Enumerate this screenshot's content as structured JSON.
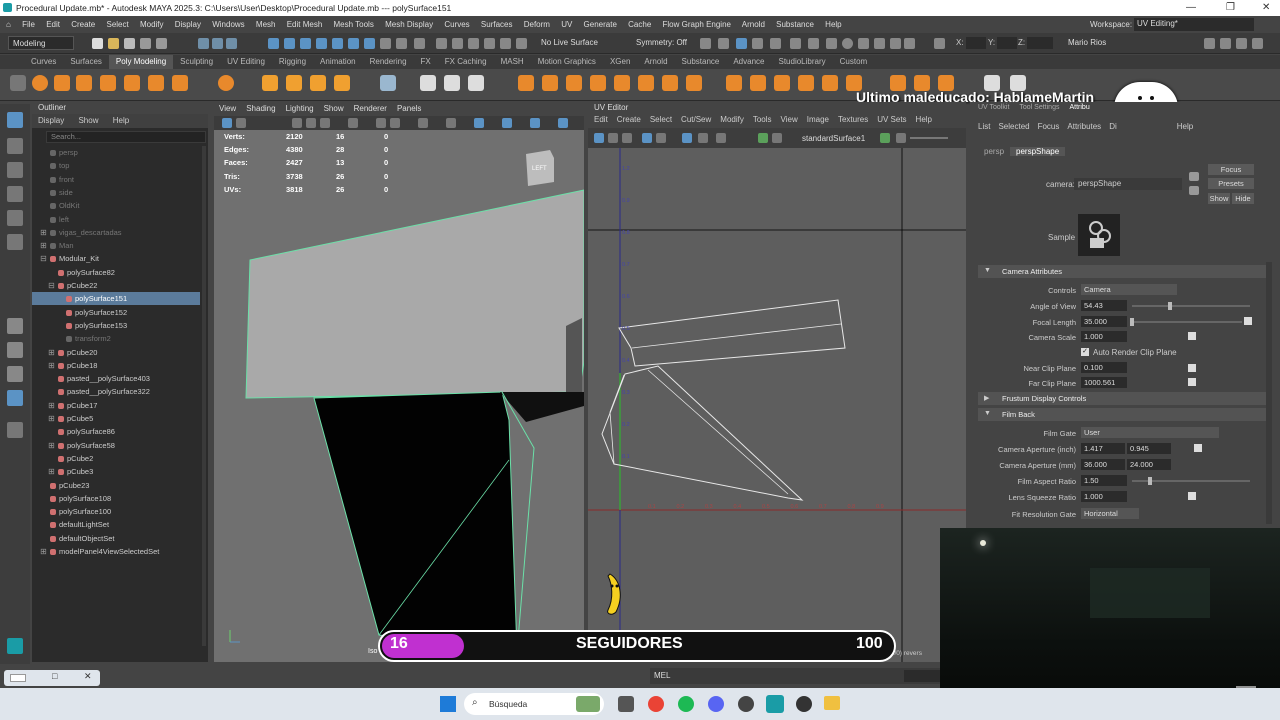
{
  "window": {
    "title": "Procedural Update.mb* - Autodesk MAYA 2025.3: C:\\Users\\User\\Desktop\\Procedural Update.mb  ---  polySurface151",
    "controls": [
      "—",
      "❐",
      "✕"
    ]
  },
  "menubar": [
    "File",
    "Edit",
    "Create",
    "Select",
    "Modify",
    "Display",
    "Windows",
    "Mesh",
    "Edit Mesh",
    "Mesh Tools",
    "Mesh Display",
    "Curves",
    "Surfaces",
    "Deform",
    "UV",
    "Generate",
    "Cache",
    "Flow Graph Engine",
    "Arnold",
    "Substance",
    "Help"
  ],
  "workspace": {
    "label": "Workspace:",
    "value": "UV Editing*"
  },
  "statusline": {
    "mode": "Modeling",
    "live_surface": "No Live Surface",
    "symmetry": "Symmetry: Off",
    "x_label": "X:",
    "y_label": "Y:",
    "z_label": "Z:",
    "user": "Mario Rios"
  },
  "shelf_tabs": [
    "Curves",
    "Surfaces",
    "Poly Modeling",
    "Sculpting",
    "UV Editing",
    "Rigging",
    "Animation",
    "Rendering",
    "FX",
    "FX Caching",
    "MASH",
    "Motion Graphics",
    "XGen",
    "Arnold",
    "Substance",
    "Advance",
    "StudioLibrary",
    "Custom"
  ],
  "shelf_active": "Poly Modeling",
  "overlay_text": "Ultimo maleducado: HablameMartin",
  "outliner": {
    "title": "Outliner",
    "menu": [
      "Display",
      "Show",
      "Help"
    ],
    "search_placeholder": "Search...",
    "rows": [
      {
        "label": "persp",
        "indent": 1,
        "dim": true
      },
      {
        "label": "top",
        "indent": 1,
        "dim": true
      },
      {
        "label": "front",
        "indent": 1,
        "dim": true
      },
      {
        "label": "side",
        "indent": 1,
        "dim": true
      },
      {
        "label": "OldKit",
        "indent": 1,
        "dim": true
      },
      {
        "label": "left",
        "indent": 1,
        "dim": true
      },
      {
        "label": "vigas_descartadas",
        "indent": 1,
        "dim": true,
        "plus": true
      },
      {
        "label": "Man",
        "indent": 1,
        "dim": true,
        "plus": true
      },
      {
        "label": "Modular_Kit",
        "indent": 1,
        "plus": true,
        "open": true
      },
      {
        "label": "polySurface82",
        "indent": 2
      },
      {
        "label": "pCube22",
        "indent": 2,
        "plus": true,
        "open": true
      },
      {
        "label": "polySurface151",
        "indent": 3,
        "sel": true
      },
      {
        "label": "polySurface152",
        "indent": 3
      },
      {
        "label": "polySurface153",
        "indent": 3
      },
      {
        "label": "transform2",
        "indent": 3,
        "dim": true
      },
      {
        "label": "pCube20",
        "indent": 2,
        "plus": true
      },
      {
        "label": "pCube18",
        "indent": 2,
        "plus": true
      },
      {
        "label": "pasted__polySurface403",
        "indent": 2
      },
      {
        "label": "pasted__polySurface322",
        "indent": 2
      },
      {
        "label": "pCube17",
        "indent": 2,
        "plus": true
      },
      {
        "label": "pCube5",
        "indent": 2,
        "plus": true
      },
      {
        "label": "polySurface86",
        "indent": 2
      },
      {
        "label": "polySurface58",
        "indent": 2,
        "plus": true
      },
      {
        "label": "pCube2",
        "indent": 2
      },
      {
        "label": "pCube3",
        "indent": 2,
        "plus": true
      },
      {
        "label": "pCube23",
        "indent": 1
      },
      {
        "label": "polySurface108",
        "indent": 1
      },
      {
        "label": "polySurface100",
        "indent": 1
      },
      {
        "label": "defaultLightSet",
        "indent": 1
      },
      {
        "label": "defaultObjectSet",
        "indent": 1
      },
      {
        "label": "modelPanel4ViewSelectedSet",
        "indent": 1,
        "plus": true
      }
    ]
  },
  "viewport": {
    "menu": [
      "View",
      "Shading",
      "Lighting",
      "Show",
      "Renderer",
      "Panels"
    ],
    "hud": [
      {
        "label": "Verts:",
        "a": "2120",
        "b": "16",
        "c": "0"
      },
      {
        "label": "Edges:",
        "a": "4380",
        "b": "28",
        "c": "0"
      },
      {
        "label": "Faces:",
        "a": "2427",
        "b": "13",
        "c": "0"
      },
      {
        "label": "Tris:",
        "a": "3738",
        "b": "26",
        "c": "0"
      },
      {
        "label": "UVs:",
        "a": "3818",
        "b": "26",
        "c": "0"
      }
    ],
    "viewcube": "LEFT",
    "bottom_label": "Iso"
  },
  "uv_editor": {
    "title": "UV Editor",
    "menu": [
      "Edit",
      "Create",
      "Select",
      "Cut/Sew",
      "Modify",
      "Tools",
      "View",
      "Image",
      "Textures",
      "UV Sets",
      "Help"
    ],
    "texture": "standardSurface1",
    "ticks_x": [
      "0.1",
      "0.2",
      "0.3",
      "0.4",
      "0.5",
      "0.6",
      "0.7",
      "0.8",
      "0.9"
    ],
    "ticks_y": [
      "1.2",
      "0.9",
      "0.8",
      "0.7",
      "0.6",
      "0.5",
      "0.4",
      "0.3",
      "0.2",
      "0.1"
    ],
    "status": "(0/2) UV shells, (0/0) overlapping UVs, (0/0) revers"
  },
  "attribute_editor": {
    "top_tabs": [
      "UV Toolkit",
      "Tool Settings",
      "Attribu"
    ],
    "menu": [
      "List",
      "Selected",
      "Focus",
      "Attributes",
      "Di",
      "Help"
    ],
    "node_tabs": [
      "persp",
      "perspShape"
    ],
    "camera_label": "camera:",
    "camera_value": "perspShape",
    "buttons": [
      "Focus",
      "Presets"
    ],
    "show": "Show",
    "hide": "Hide",
    "sample_label": "Sample",
    "sections": {
      "camera_attributes": "Camera Attributes",
      "frustum": "Frustum Display Controls",
      "film_back": "Film Back"
    },
    "fields": {
      "controls_label": "Controls",
      "controls_value": "Camera",
      "aov_label": "Angle of View",
      "aov": "54.43",
      "focal_label": "Focal Length",
      "focal": "35.000",
      "scale_label": "Camera Scale",
      "scale": "1.000",
      "auto_clip": "Auto Render Clip Plane",
      "near_label": "Near Clip Plane",
      "near": "0.100",
      "far_label": "Far Clip Plane",
      "far": "1000.561",
      "gate_label": "Film Gate",
      "gate": "User",
      "ap_in_label": "Camera Aperture (inch)",
      "ap_in_a": "1.417",
      "ap_in_b": "0.945",
      "ap_mm_label": "Camera Aperture (mm)",
      "ap_mm_a": "36.000",
      "ap_mm_b": "24.000",
      "aspect_label": "Film Aspect Ratio",
      "aspect": "1.50",
      "squeeze_label": "Lens Squeeze Ratio",
      "squeeze": "1.000",
      "fit_label": "Fit Resolution Gate",
      "fit": "Horizontal"
    }
  },
  "banner": {
    "left": "16",
    "label": "SEGUIDORES",
    "right": "100",
    "progress": 0.16
  },
  "command_line": {
    "label": "MEL"
  },
  "taskbar": {
    "search": "Búsqueda"
  },
  "colors": {
    "accent": "#5b7b9b",
    "banner_fill": "#c030d0",
    "wire": "#6be0a8"
  }
}
